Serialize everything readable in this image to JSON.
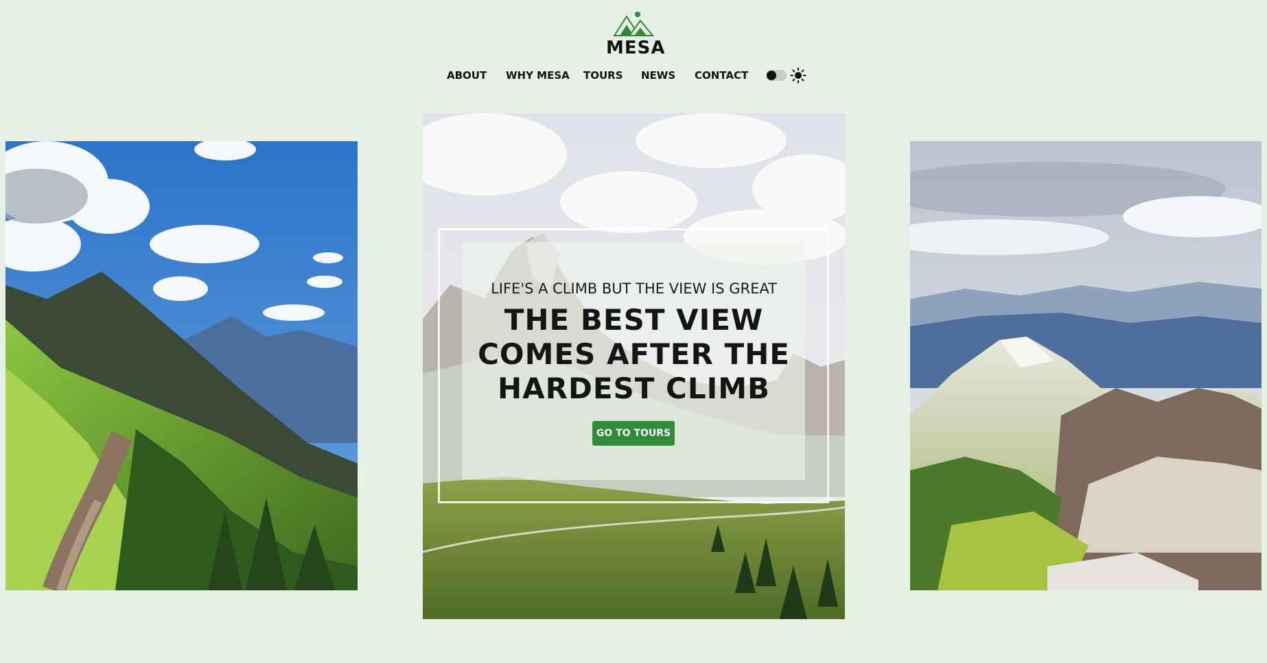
{
  "brand": {
    "name": "MESA",
    "accent_color": "#2f8a3a",
    "background_color": "#e6f0e4",
    "logo_icon": "mountains-icon"
  },
  "nav": {
    "items": [
      {
        "label": "ABOUT"
      },
      {
        "label": "WHY MESA"
      },
      {
        "label": "TOURS"
      },
      {
        "label": "NEWS"
      },
      {
        "label": "CONTACT"
      }
    ],
    "theme_toggle": {
      "state": "light",
      "icon": "sun-icon"
    }
  },
  "hero": {
    "tagline": "LIFE'S A CLIMB BUT THE VIEW IS GREAT",
    "title_lines": [
      "THE BEST VIEW",
      "COMES AFTER THE",
      "HARDEST CLIMB"
    ],
    "button_label": "GO TO TOURS",
    "images": [
      {
        "name": "mountain-trail-photo"
      },
      {
        "name": "mountain-valley-photo"
      },
      {
        "name": "mountain-peak-photo"
      }
    ]
  }
}
